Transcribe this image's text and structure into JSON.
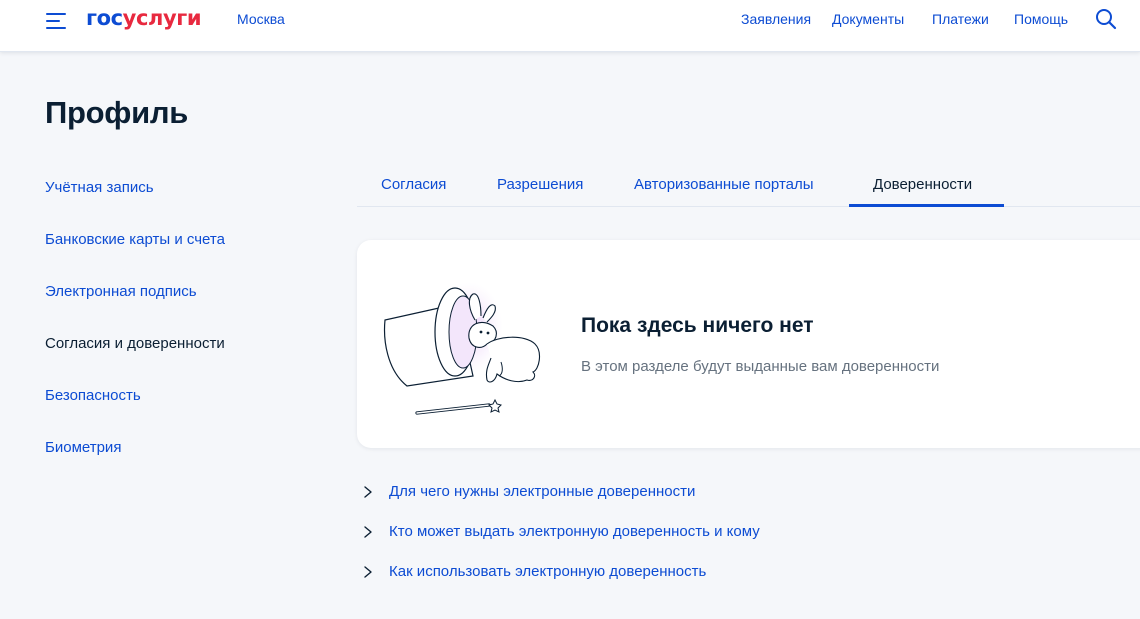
{
  "header": {
    "logo_part_a": "гос",
    "logo_part_b": "услуги",
    "city": "Москва",
    "nav": [
      "Заявления",
      "Документы",
      "Платежи",
      "Помощь"
    ],
    "icons": [
      "burger-menu-icon",
      "search-icon"
    ]
  },
  "page": {
    "title": "Профиль"
  },
  "sidebar": {
    "items": [
      {
        "label": "Учётная запись",
        "active": false
      },
      {
        "label": "Банковские карты и счета",
        "active": false
      },
      {
        "label": "Электронная подпись",
        "active": false
      },
      {
        "label": "Согласия и доверенности",
        "active": true
      },
      {
        "label": "Безопасность",
        "active": false
      },
      {
        "label": "Биометрия",
        "active": false
      }
    ]
  },
  "tabs": {
    "items": [
      {
        "label": "Согласия",
        "active": false
      },
      {
        "label": "Разрешения",
        "active": false
      },
      {
        "label": "Авторизованные порталы",
        "active": false
      },
      {
        "label": "Доверенности",
        "active": true
      }
    ]
  },
  "empty_state": {
    "title": "Пока здесь ничего нет",
    "text": "В этом разделе будут выданные вам доверенности",
    "illustration": "magic-hat-rabbit-illustration"
  },
  "faq": {
    "items": [
      "Для чего нужны электронные доверенности",
      "Кто может выдать электронную доверенность и кому",
      "Как использовать электронную доверенность"
    ]
  },
  "colors": {
    "link": "#0d4cd3",
    "logo_accent": "#e8293f",
    "text": "#0b1f33",
    "muted": "#66727f",
    "background": "#f5f7fa"
  }
}
